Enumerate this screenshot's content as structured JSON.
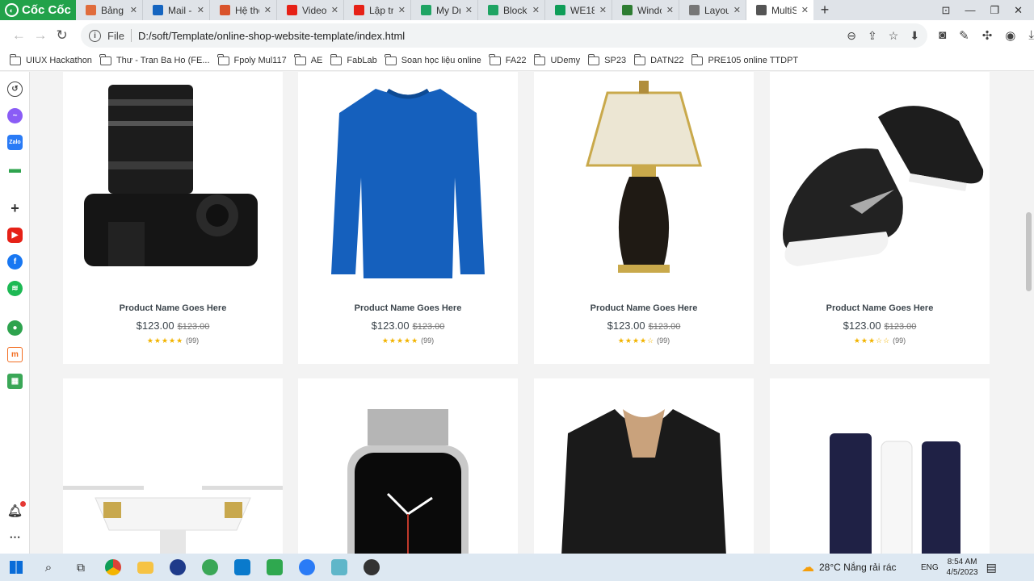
{
  "browser": {
    "brand": "Cốc Cốc",
    "tabs": [
      {
        "label": "Bảng c",
        "color": "#e06c3c"
      },
      {
        "label": "Mail -",
        "color": "#1565c0"
      },
      {
        "label": "Hệ thố",
        "color": "#d9532b"
      },
      {
        "label": "Video",
        "color": "#e62117"
      },
      {
        "label": "Lập trì",
        "color": "#e62117"
      },
      {
        "label": "My Dri",
        "color": "#1fa463"
      },
      {
        "label": "Block2",
        "color": "#1fa463"
      },
      {
        "label": "WE18",
        "color": "#0f9d58"
      },
      {
        "label": "Windo",
        "color": "#2e7d32"
      },
      {
        "label": "Layout",
        "color": "#777777"
      },
      {
        "label": "MultiS",
        "color": "#555555"
      }
    ],
    "active_tab_index": 10,
    "new_tab": "+",
    "address": {
      "scheme_label": "File",
      "url": "D:/soft/Template/online-shop-website-template/index.html"
    },
    "bookmarks": [
      "UIUX Hackathon",
      "Thư - Tran Ba Ho (FE...",
      "Fpoly Mul117",
      "AE",
      "FabLab",
      "Soan học liệu online",
      "FA22",
      "UDemy",
      "SP23",
      "DATN22",
      "PRE105 online TTDPT"
    ]
  },
  "products": [
    {
      "name": "Product Name Goes Here",
      "price": "$123.00",
      "old_price": "$123.00",
      "stars": "★★★★★",
      "count": "(99)",
      "image": "camera"
    },
    {
      "name": "Product Name Goes Here",
      "price": "$123.00",
      "old_price": "$123.00",
      "stars": "★★★★★",
      "count": "(99)",
      "image": "sweater"
    },
    {
      "name": "Product Name Goes Here",
      "price": "$123.00",
      "old_price": "$123.00",
      "stars": "★★★★☆",
      "count": "(99)",
      "image": "lamp"
    },
    {
      "name": "Product Name Goes Here",
      "price": "$123.00",
      "old_price": "$123.00",
      "stars": "★★★☆☆",
      "count": "(99)",
      "image": "shoes"
    },
    {
      "image": "drone"
    },
    {
      "image": "watch"
    },
    {
      "image": "blouse"
    },
    {
      "image": "cosmetics"
    }
  ],
  "back_to_top": "⌃",
  "taskbar": {
    "weather": "28°C  Nắng rải rác",
    "lang": "ENG",
    "time": "8:54 AM",
    "date": "4/5/2023"
  }
}
